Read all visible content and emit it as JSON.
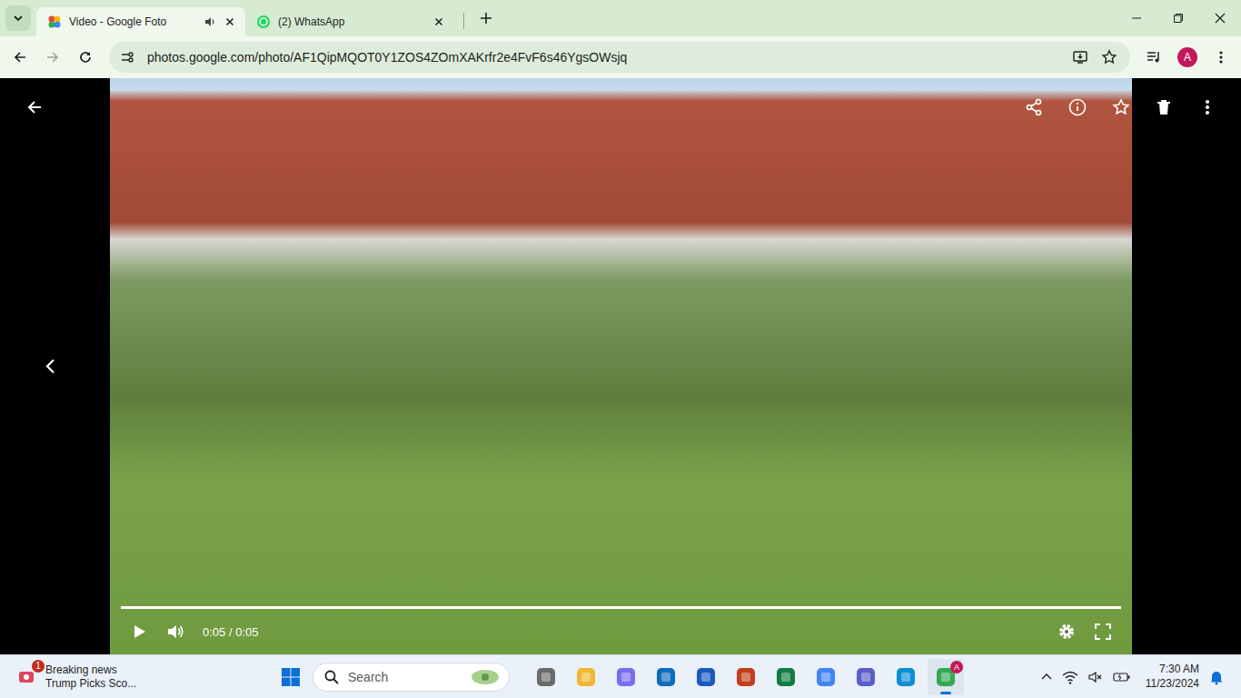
{
  "browser": {
    "tabs": [
      {
        "label": "Video - Google Foto",
        "selected": true,
        "playing_audio": true
      },
      {
        "label": "(2) WhatsApp",
        "selected": false,
        "playing_audio": false
      }
    ],
    "address": "photos.google.com/photo/AF1QipMQOT0Y1ZOS4ZOmXAKrfr2e4FvF6s46YgsOWsjq",
    "bookmarked": false,
    "profile": "A"
  },
  "player": {
    "time": "0:05 / 0:05",
    "level": 1,
    "playing": false,
    "favorite": false
  },
  "taskbar": {
    "news": {
      "badge": "1",
      "title": "Breaking news",
      "subtitle": "Trump Picks Sco..."
    },
    "search": {
      "placeholder": "Search"
    },
    "apps": [
      {
        "color": "#6b6b6b",
        "selected": false,
        "badge": ""
      },
      {
        "color": "#f2b632",
        "selected": false,
        "badge": ""
      },
      {
        "color": "#7a6cf0",
        "selected": false,
        "badge": ""
      },
      {
        "color": "#0f6cbd",
        "selected": false,
        "badge": ""
      },
      {
        "color": "#185abd",
        "selected": false,
        "badge": ""
      },
      {
        "color": "#c43e1c",
        "selected": false,
        "badge": ""
      },
      {
        "color": "#107c41",
        "selected": false,
        "badge": ""
      },
      {
        "color": "#4285f4",
        "selected": false,
        "badge": ""
      },
      {
        "color": "#5b5fc7",
        "selected": false,
        "badge": ""
      },
      {
        "color": "#0c8fd6",
        "selected": false,
        "badge": ""
      },
      {
        "color": "#34a853",
        "selected": true,
        "badge": "A"
      }
    ],
    "clock": {
      "time": "7:30 AM",
      "date": "11/23/2024"
    }
  }
}
